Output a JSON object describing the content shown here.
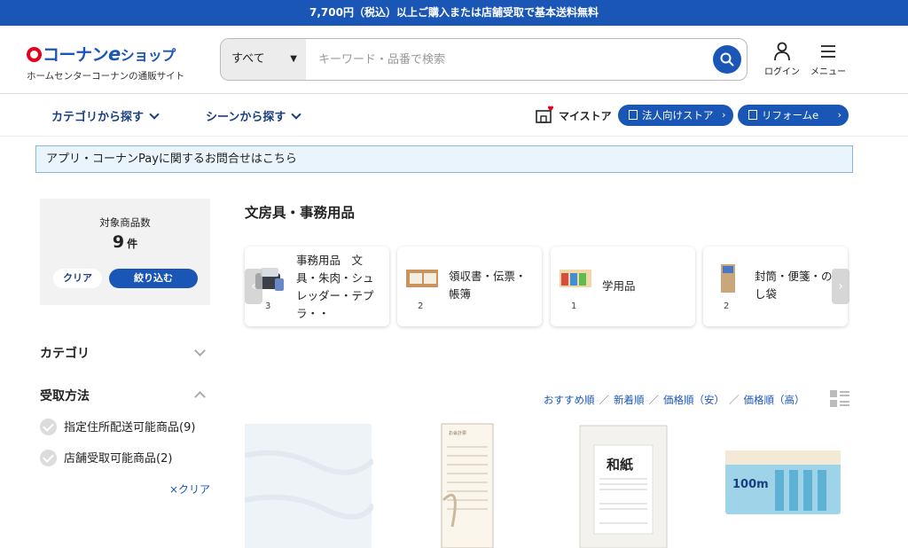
{
  "promo": {
    "text": "7,700円（税込）以上ご購入または店舗受取で基本送料無料"
  },
  "header": {
    "logo_name": "コーナン",
    "logo_e": "e",
    "logo_shop": "ショップ",
    "logo_sub": "ホームセンターコーナンの通販サイト",
    "search_category": "すべて",
    "search_placeholder": "キーワード・品番で検索",
    "login_label": "ログイン",
    "menu_label": "メニュー"
  },
  "nav": {
    "category_search": "カテゴリから探す",
    "scene_search": "シーンから探す",
    "my_store": "マイストア",
    "corporate_store": "法人向けストア",
    "reform": "リフォームe"
  },
  "notice": {
    "text": "アプリ・コーナンPayに関するお問合せはこちら"
  },
  "sidebar": {
    "count_label": "対象商品数",
    "count_value": "9",
    "count_unit": "件",
    "clear_button": "クリア",
    "narrow_button": "絞り込む",
    "category_heading": "カテゴリ",
    "pickup_heading": "受取方法",
    "pickup_options": [
      {
        "label": "指定住所配送可能商品(9)"
      },
      {
        "label": "店舗受取可能商品(2)"
      }
    ],
    "clear_link": "×クリア"
  },
  "main": {
    "title": "文房具・事務用品",
    "categories": [
      {
        "label": "事務用品　文具・朱肉・シュレッダー・テプラ・・",
        "count": "3"
      },
      {
        "label": "領収書・伝票・帳簿",
        "count": "2"
      },
      {
        "label": "学用品",
        "count": "1"
      },
      {
        "label": "封筒・便箋・のし袋",
        "count": "2"
      }
    ],
    "sort": {
      "recommended": "おすすめ順",
      "newest": "新着順",
      "price_low": "価格順（安）",
      "price_high": "価格順（高）",
      "separator": "／"
    },
    "products": [
      {
        "name": "white-paper-product"
      },
      {
        "name": "bill-form-product",
        "label": "お会計票"
      },
      {
        "name": "washi-paper-product",
        "label": "和紙"
      },
      {
        "name": "envelope-pack-product",
        "label": "100m"
      }
    ]
  },
  "colors": {
    "brand_blue": "#1a56b5",
    "brand_red": "#e3001b",
    "notice_bg": "#e9f4fb"
  }
}
